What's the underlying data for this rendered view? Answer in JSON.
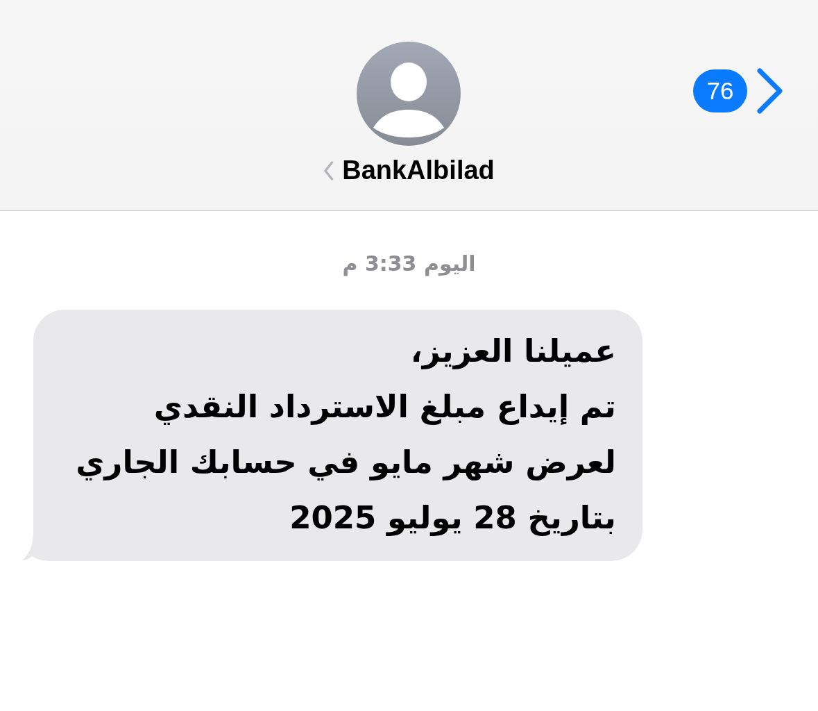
{
  "header": {
    "contact_name": "BankAlbilad",
    "back_button": {
      "unread_count": "76"
    }
  },
  "messages": [
    {
      "kind": "timestamp",
      "text": "اليوم 3:33 م"
    },
    {
      "kind": "incoming",
      "text": "عميلنا العزيز،\nتم إيداع مبلغ الاسترداد النقدي\nلعرض شهر مايو في حسابك الجاري\nبتاريخ 28 يوليو 2025"
    }
  ]
}
